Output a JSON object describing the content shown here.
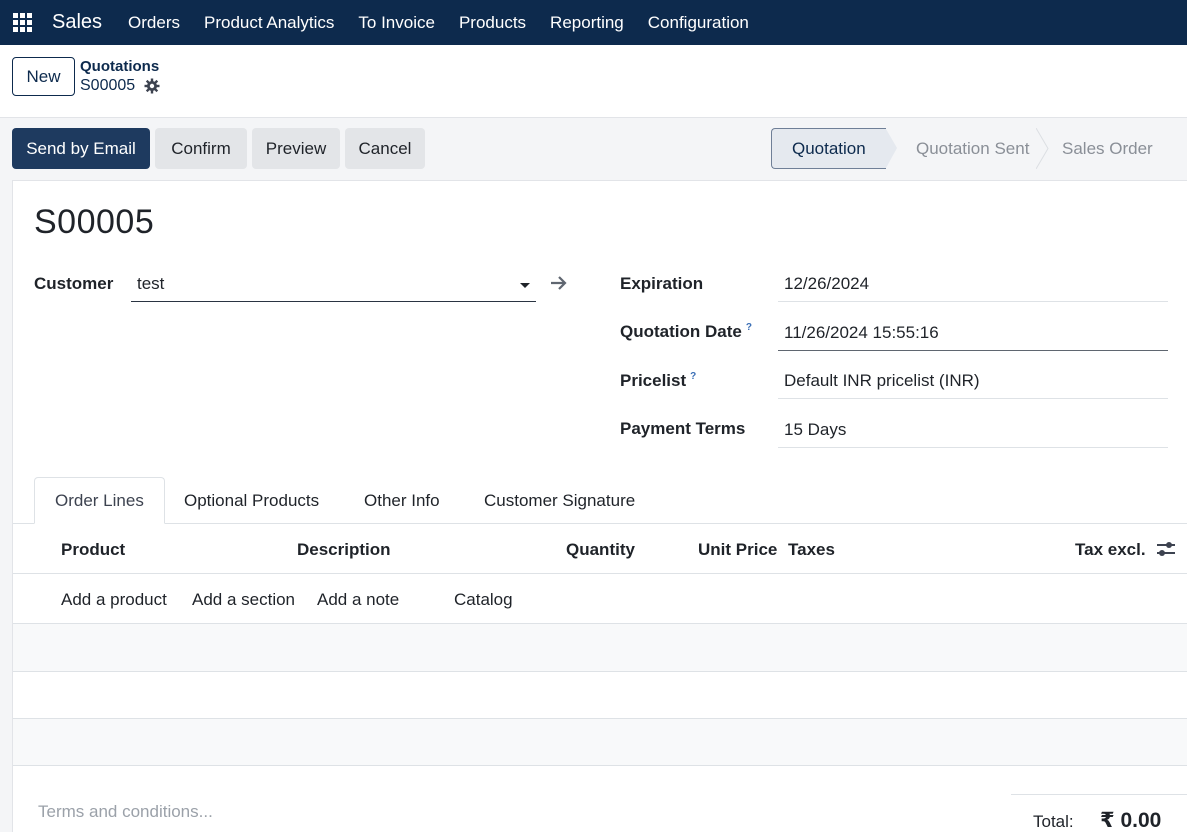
{
  "nav": {
    "brand": "Sales",
    "items": [
      "Orders",
      "Product Analytics",
      "To Invoice",
      "Products",
      "Reporting",
      "Configuration"
    ]
  },
  "control": {
    "new_label": "New",
    "breadcrumb_parent": "Quotations",
    "breadcrumb_current": "S00005"
  },
  "actions": {
    "send_email": "Send by Email",
    "confirm": "Confirm",
    "preview": "Preview",
    "cancel": "Cancel"
  },
  "status": {
    "stages": [
      "Quotation",
      "Quotation Sent",
      "Sales Order"
    ],
    "active": "Quotation"
  },
  "form": {
    "title": "S00005",
    "customer_label": "Customer",
    "customer_value": "test",
    "expiration_label": "Expiration",
    "expiration_value": "12/26/2024",
    "quotation_date_label": "Quotation Date",
    "quotation_date_value": "11/26/2024 15:55:16",
    "pricelist_label": "Pricelist",
    "pricelist_value": "Default INR pricelist (INR)",
    "payment_terms_label": "Payment Terms",
    "payment_terms_value": "15 Days",
    "help_marker": "?"
  },
  "tabs": [
    "Order Lines",
    "Optional Products",
    "Other Info",
    "Customer Signature"
  ],
  "table": {
    "headers": {
      "product": "Product",
      "description": "Description",
      "quantity": "Quantity",
      "unit_price": "Unit Price",
      "taxes": "Taxes",
      "tax_excl": "Tax excl."
    },
    "add_links": {
      "add_product": "Add a product",
      "add_section": "Add a section",
      "add_note": "Add a note",
      "catalog": "Catalog"
    }
  },
  "footer": {
    "terms_placeholder": "Terms and conditions...",
    "total_label": "Total:",
    "total_value": "₹ 0.00"
  },
  "colors": {
    "navbar": "#0d2a4d",
    "primary_button": "#1e3a5f",
    "help_marker": "#3b6fb6"
  }
}
